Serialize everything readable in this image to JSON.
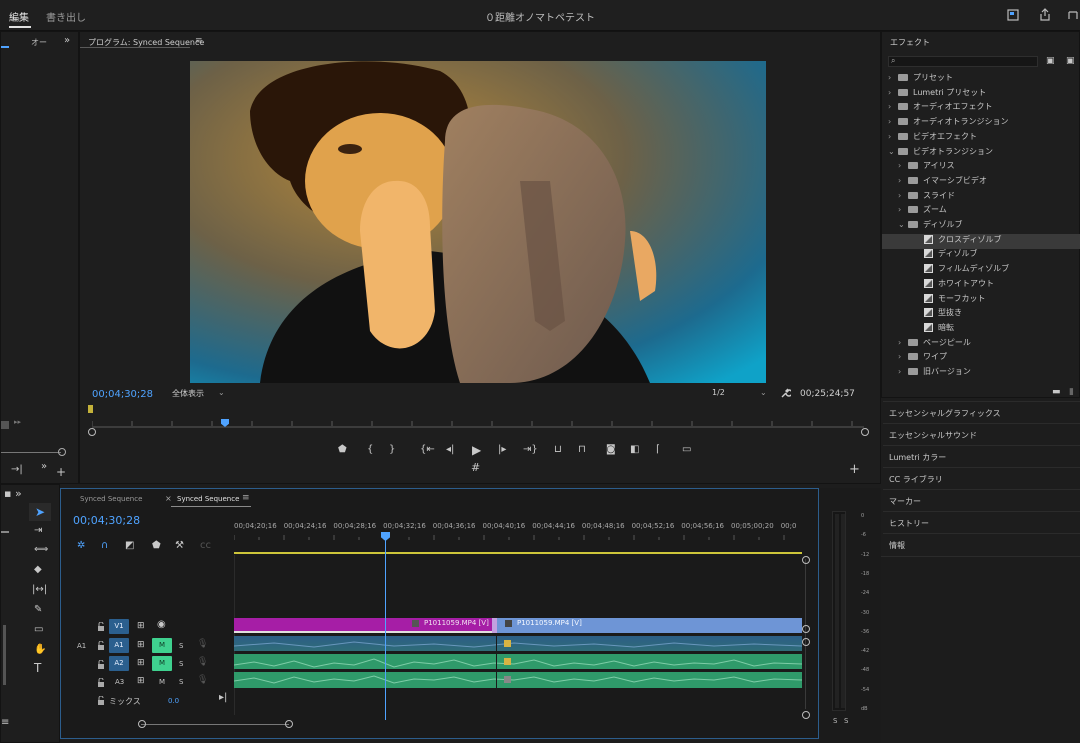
{
  "topbar": {
    "tab_edit": "編集",
    "tab_export": "書き出し",
    "project_title": "０距離オノマトペテスト"
  },
  "left_panel": {
    "tab_partial": "オー"
  },
  "program": {
    "header": "プログラム: Synced Sequence",
    "timecode_current": "00;04;30;28",
    "fit": "全体表示",
    "resolution": "1/2",
    "timecode_duration": "00;25;24;57"
  },
  "effects": {
    "header": "エフェクト",
    "search_placeholder": "",
    "items": [
      {
        "label": "プリセット",
        "type": "folder-star",
        "level": 0,
        "open": false
      },
      {
        "label": "Lumetri プリセット",
        "type": "folder-star",
        "level": 0,
        "open": false
      },
      {
        "label": "オーディオエフェクト",
        "type": "folder",
        "level": 0,
        "open": false
      },
      {
        "label": "オーディオトランジション",
        "type": "folder",
        "level": 0,
        "open": false
      },
      {
        "label": "ビデオエフェクト",
        "type": "folder",
        "level": 0,
        "open": false
      },
      {
        "label": "ビデオトランジション",
        "type": "folder",
        "level": 0,
        "open": true
      },
      {
        "label": "アイリス",
        "type": "folder",
        "level": 1,
        "open": false
      },
      {
        "label": "イマーシブビデオ",
        "type": "folder",
        "level": 1,
        "open": false
      },
      {
        "label": "スライド",
        "type": "folder",
        "level": 1,
        "open": false
      },
      {
        "label": "ズーム",
        "type": "folder",
        "level": 1,
        "open": false
      },
      {
        "label": "ディゾルブ",
        "type": "folder",
        "level": 1,
        "open": true
      },
      {
        "label": "クロスディゾルブ",
        "type": "effect",
        "level": 2,
        "selected": true
      },
      {
        "label": "ディゾルブ",
        "type": "effect",
        "level": 2
      },
      {
        "label": "フィルムディゾルブ",
        "type": "effect",
        "level": 2
      },
      {
        "label": "ホワイトアウト",
        "type": "effect",
        "level": 2
      },
      {
        "label": "モーフカット",
        "type": "effect",
        "level": 2
      },
      {
        "label": "型抜き",
        "type": "effect",
        "level": 2
      },
      {
        "label": "暗転",
        "type": "effect",
        "level": 2
      },
      {
        "label": "ページピール",
        "type": "folder",
        "level": 1,
        "open": false
      },
      {
        "label": "ワイプ",
        "type": "folder",
        "level": 1,
        "open": false
      },
      {
        "label": "旧バージョン",
        "type": "folder",
        "level": 1,
        "open": false
      }
    ]
  },
  "side_panels": [
    "エッセンシャルグラフィックス",
    "エッセンシャルサウンド",
    "Lumetri カラー",
    "CC ライブラリ",
    "マーカー",
    "ヒストリー",
    "情報"
  ],
  "timeline": {
    "tab1": "Synced Sequence",
    "tab2": "Synced Sequence",
    "timecode": "00;04;30;28",
    "ruler": [
      "00;04;20;16",
      "00;04;24;16",
      "00;04;28;16",
      "00;04;32;16",
      "00;04;36;16",
      "00;04;40;16",
      "00;04;44;16",
      "00;04;48;16",
      "00;04;52;16",
      "00;04;56;16",
      "00;05;00;20",
      "00;0"
    ],
    "tracks": {
      "v1": "V1",
      "a1_src": "A1",
      "a1": "A1",
      "a2": "A2",
      "a3": "A3",
      "m": "M",
      "s": "S",
      "mix_label": "ミックス",
      "mix_value": "0.0"
    },
    "clip1": "P1011059.MP4 [V]",
    "clip2": "P1011059.MP4 [V]"
  },
  "meter": {
    "scale": [
      "0",
      "-6",
      "-12",
      "-18",
      "-24",
      "-30",
      "-36",
      "-42",
      "-48",
      "-54",
      "dB"
    ],
    "solo_left": "S",
    "solo_right": "S"
  },
  "colors": {
    "accent_blue": "#4fa3ff",
    "clip_magenta": "#a61ea6",
    "clip_blue": "#6e95d6",
    "audio_green": "#2f9a6a",
    "mute_green": "#3fd18f"
  }
}
